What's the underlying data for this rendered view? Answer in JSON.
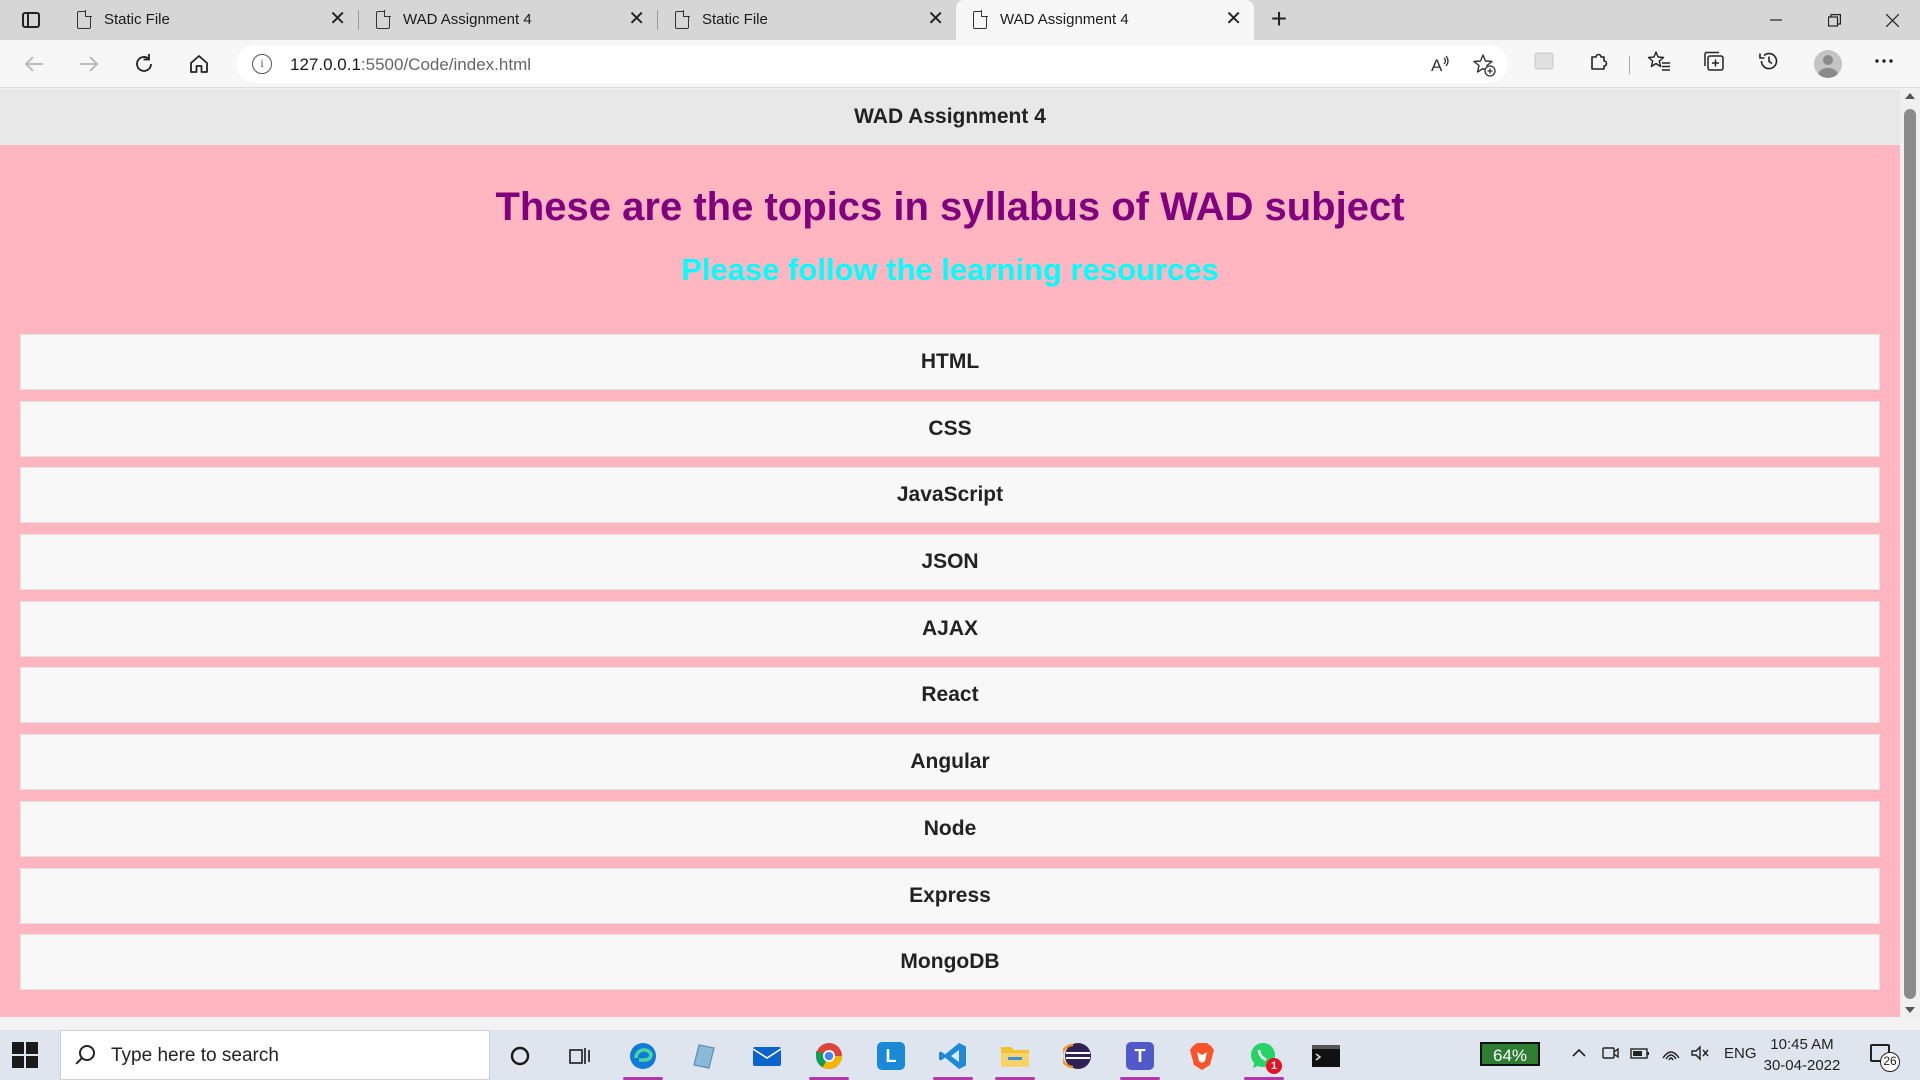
{
  "browser": {
    "tabs": [
      {
        "title": "Static File",
        "active": false
      },
      {
        "title": "WAD Assignment 4",
        "active": false
      },
      {
        "title": "Static File",
        "active": false
      },
      {
        "title": "WAD Assignment 4",
        "active": true
      }
    ],
    "close_glyph": "✕",
    "new_tab_glyph": "+",
    "address": {
      "host": "127.0.0.1",
      "path": ":5500/Code/index.html"
    },
    "icons": {
      "back": "back-arrow-icon",
      "forward": "forward-arrow-icon",
      "reload": "reload-icon",
      "home": "home-icon",
      "read_aloud": "read-aloud-icon",
      "favorite_add": "add-favorite-icon",
      "extensions": "puzzle-icon",
      "favorites": "favorites-icon",
      "collections": "collections-icon",
      "history": "history-icon",
      "more": "more-icon"
    }
  },
  "page": {
    "header": "WAD Assignment 4",
    "heading": "These are the topics in syllabus of WAD subject",
    "subheading": "Please follow the learning resources",
    "topics": [
      "HTML",
      "CSS",
      "JavaScript",
      "JSON",
      "AJAX",
      "React",
      "Angular",
      "Node",
      "Express",
      "MongoDB"
    ]
  },
  "colors": {
    "page_bg": "#ffb6c1",
    "heading": "#800080",
    "subheading": "#00ffff",
    "topic_bg": "#f8f8f8",
    "header_bg": "#e8e8e8"
  },
  "taskbar": {
    "search_placeholder": "Type here to search",
    "apps": [
      "cortana",
      "task-view",
      "edge",
      "notepad",
      "mail",
      "chrome",
      "libre",
      "vscode",
      "file-explorer",
      "eclipse",
      "teams",
      "brave",
      "whatsapp",
      "terminal"
    ],
    "whatsapp_badge": "1",
    "battery": "64%",
    "language": "ENG",
    "time": "10:45 AM",
    "date": "30-04-2022",
    "notifications": "26"
  }
}
